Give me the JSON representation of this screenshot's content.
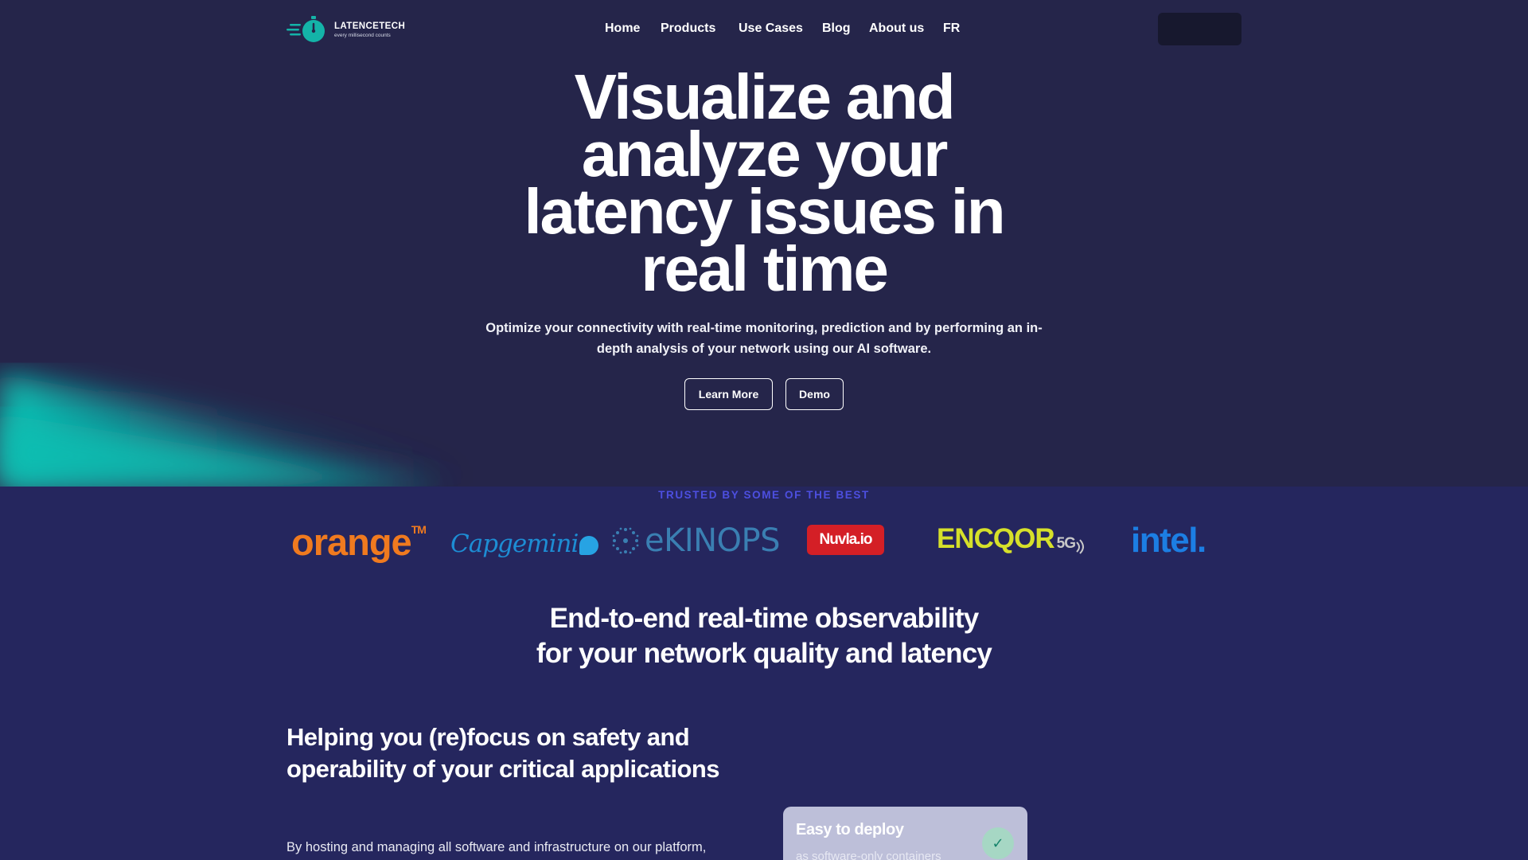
{
  "brand": {
    "name": "LATENCETECH",
    "tagline": "every millisecond counts"
  },
  "nav": {
    "items": [
      {
        "label": "Home"
      },
      {
        "label": "Products"
      },
      {
        "label": "Use Cases"
      },
      {
        "label": "Blog"
      },
      {
        "label": "About us"
      },
      {
        "label": "FR"
      }
    ],
    "cta_label": ""
  },
  "hero": {
    "title_lines": [
      "Visualize and",
      "analyze your",
      "latency issues in",
      "real time"
    ],
    "subtitle": "Optimize your connectivity with real-time monitoring, prediction and by performing an in-depth analysis of your network using our AI software.",
    "buttons": {
      "learn_more": "Learn More",
      "demo": "Demo"
    }
  },
  "trusted": {
    "label": "TRUSTED BY SOME OF THE BEST",
    "logos": {
      "orange": "orange",
      "orange_tm": "TM",
      "capgemini": "Capgemini",
      "ekinops": "eKINOPS",
      "nuvla": "Nuvla.io",
      "encqor": "ENCQOR",
      "encqor_5g": "5G",
      "intel": "intel."
    }
  },
  "observability": {
    "title_lines": [
      "End-to-end real-time observability",
      "for your network quality and latency"
    ]
  },
  "helping": {
    "title": "Helping you (re)focus on safety and operability of your critical applications",
    "body": "By hosting and managing all software and infrastructure on our platform,"
  },
  "deploy_card": {
    "title": "Easy to deploy",
    "subtitle": "as software-only containers",
    "check_icon": "✓"
  },
  "colors": {
    "hero_bg": "#25254a",
    "section_bg": "#25265e",
    "accent_teal": "#12c2b4",
    "trusted_label": "#4d4fe0"
  }
}
